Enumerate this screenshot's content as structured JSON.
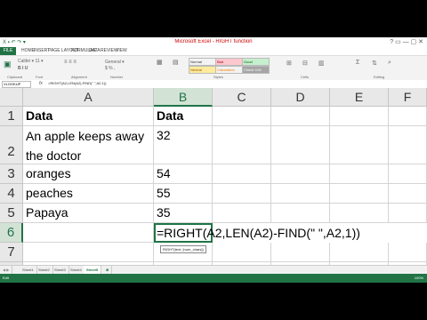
{
  "window": {
    "title": "Microsoft Excel - RIGHT function",
    "quick_access": "X ▪ ↶ ↷ ▾",
    "controls": "? ▭ — ▢ ✕"
  },
  "ribbon": {
    "tabs": [
      "FILE",
      "HOME",
      "INSERT",
      "PAGE LAYOUT",
      "FORMULAS",
      "DATA",
      "REVIEW",
      "VIEW"
    ],
    "groups": [
      "Clipboard",
      "Font",
      "Alignment",
      "Number",
      "Styles",
      "Cells",
      "Editing"
    ],
    "style_boxes": [
      "Normal",
      "Bad",
      "Good",
      "Neutral",
      "Calculation",
      "Check Cell"
    ]
  },
  "formula_bar": {
    "name_box": "VLOOKUP",
    "fx": "fx",
    "formula": "=RIGHT(A2,LEN(A2)-FIND(\" \",A2,1))"
  },
  "grid": {
    "columns": [
      "A",
      "B",
      "C",
      "D",
      "E",
      "F"
    ],
    "selected_column": "B",
    "rows": [
      {
        "num": "1",
        "a": "Data",
        "b": "Data"
      },
      {
        "num": "2",
        "a": "An apple keeps away the doctor",
        "b": "32"
      },
      {
        "num": "3",
        "a": "oranges",
        "b": "54"
      },
      {
        "num": "4",
        "a": "peaches",
        "b": "55"
      },
      {
        "num": "5",
        "a": "Papaya",
        "b": "35"
      },
      {
        "num": "6",
        "a": "",
        "b": "=RIGHT(A2,LEN(A2)-FIND(\" \",A2,1))"
      },
      {
        "num": "7",
        "a": "",
        "b": ""
      },
      {
        "num": "8",
        "a": "",
        "b": ""
      }
    ],
    "tooltip": "RIGHT(text, [num_chars])"
  },
  "sheets": {
    "tabs": [
      "Sheet1",
      "Sheet2",
      "Sheet3",
      "Sheet4",
      "Sheet5"
    ],
    "active": "Sheet5"
  },
  "status": {
    "mode": "Edit",
    "zoom": "100%"
  }
}
